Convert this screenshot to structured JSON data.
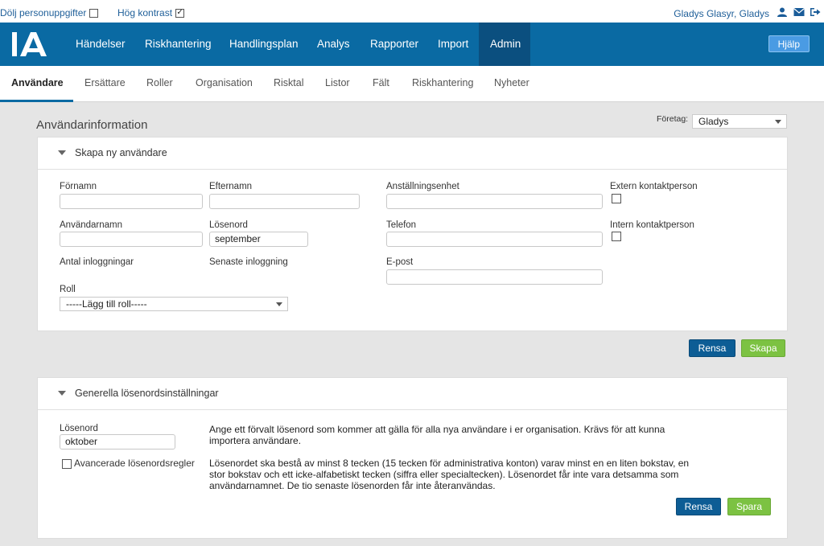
{
  "topbar": {
    "hide_personal": "Dölj personuppgifter",
    "high_contrast": "Hög kontrast",
    "high_contrast_checked": "✓",
    "user_name": "Gladys Glasyr, Gladys"
  },
  "nav": {
    "items": [
      "Händelser",
      "Riskhantering",
      "Handlingsplan",
      "Analys",
      "Rapporter",
      "Import",
      "Admin"
    ],
    "help": "Hjälp"
  },
  "subnav": {
    "tabs": [
      "Användare",
      "Ersättare",
      "Roller",
      "Organisation",
      "Risktal",
      "Listor",
      "Fält",
      "Riskhantering",
      "Nyheter"
    ]
  },
  "page": {
    "title": "Användarinformation",
    "company_label": "Företag:",
    "company_value": "Gladys"
  },
  "create_user": {
    "title": "Skapa ny användare",
    "first_name": "Förnamn",
    "last_name": "Efternamn",
    "unit": "Anställningsenhet",
    "external_contact": "Extern kontaktperson",
    "username": "Användarnamn",
    "password": "Lösenord",
    "password_value": "september",
    "phone": "Telefon",
    "internal_contact": "Intern kontaktperson",
    "login_count": "Antal inloggningar",
    "last_login": "Senaste inloggning",
    "email": "E-post",
    "role": "Roll",
    "role_value": "-----Lägg till roll-----",
    "clear": "Rensa",
    "create": "Skapa"
  },
  "password_settings": {
    "title": "Generella lösenordsinställningar",
    "password": "Lösenord",
    "password_value": "oktober",
    "advanced": "Avancerade lösenordsregler",
    "desc1_line1": "Ange ett förvalt lösenord som kommer att gälla för alla nya användare i er organisation. Krävs för att kunna",
    "desc1_line2": "importera användare.",
    "desc2_line1": "Lösenordet ska bestå av minst 8 tecken (15 tecken för administrativa konton) varav minst en en liten bokstav, en",
    "desc2_line2": "stor bokstav och ett icke-alfabetiskt tecken (siffra eller specialtecken). Lösenordet får inte vara detsamma som",
    "desc2_line3": "användarnamnet. De tio senaste lösenorden får inte återanvändas.",
    "clear": "Rensa",
    "save": "Spara"
  }
}
